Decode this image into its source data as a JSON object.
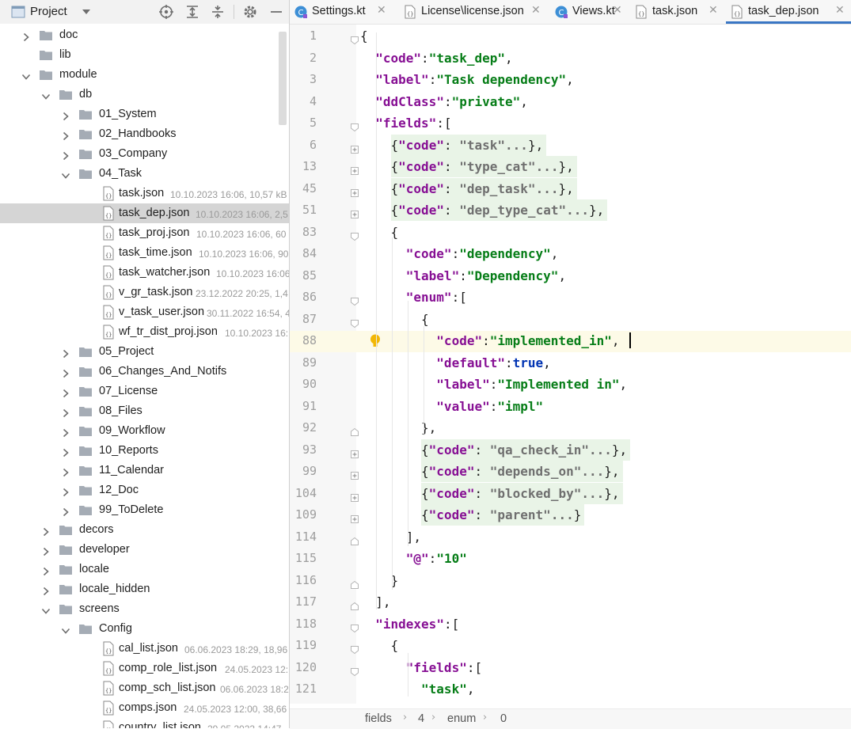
{
  "project_panel": {
    "title": "Project",
    "tree": [
      {
        "name": "doc",
        "type": "folder",
        "expanded": false,
        "meta": ""
      },
      {
        "name": "lib",
        "type": "folder",
        "expanded": null,
        "meta": ""
      },
      {
        "name": "module",
        "type": "folder",
        "expanded": true,
        "meta": ""
      },
      {
        "name": "db",
        "type": "folder",
        "expanded": true,
        "meta": ""
      },
      {
        "name": "01_System",
        "type": "folder",
        "expanded": false,
        "meta": ""
      },
      {
        "name": "02_Handbooks",
        "type": "folder",
        "expanded": false,
        "meta": ""
      },
      {
        "name": "03_Company",
        "type": "folder",
        "expanded": false,
        "meta": ""
      },
      {
        "name": "04_Task",
        "type": "folder",
        "expanded": true,
        "meta": ""
      },
      {
        "name": "task.json",
        "type": "file",
        "meta": "10.10.2023 16:06, 10,57 kB"
      },
      {
        "name": "task_dep.json",
        "type": "file",
        "meta": "10.10.2023 16:06, 2,5",
        "selected": true
      },
      {
        "name": "task_proj.json",
        "type": "file",
        "meta": "10.10.2023 16:06, 60"
      },
      {
        "name": "task_time.json",
        "type": "file",
        "meta": "10.10.2023 16:06, 90"
      },
      {
        "name": "task_watcher.json",
        "type": "file",
        "meta": "10.10.2023 16:06"
      },
      {
        "name": "v_gr_task.json",
        "type": "file",
        "meta": "23.12.2022 20:25, 1,4"
      },
      {
        "name": "v_task_user.json",
        "type": "file",
        "meta": "30.11.2022 16:54, 4"
      },
      {
        "name": "wf_tr_dist_proj.json",
        "type": "file",
        "meta": "10.10.2023 16:"
      },
      {
        "name": "05_Project",
        "type": "folder",
        "expanded": false,
        "meta": ""
      },
      {
        "name": "06_Changes_And_Notifs",
        "type": "folder",
        "expanded": false,
        "meta": ""
      },
      {
        "name": "07_License",
        "type": "folder",
        "expanded": false,
        "meta": ""
      },
      {
        "name": "08_Files",
        "type": "folder",
        "expanded": false,
        "meta": ""
      },
      {
        "name": "09_Workflow",
        "type": "folder",
        "expanded": false,
        "meta": ""
      },
      {
        "name": "10_Reports",
        "type": "folder",
        "expanded": false,
        "meta": ""
      },
      {
        "name": "11_Calendar",
        "type": "folder",
        "expanded": false,
        "meta": ""
      },
      {
        "name": "12_Doc",
        "type": "folder",
        "expanded": false,
        "meta": ""
      },
      {
        "name": "99_ToDelete",
        "type": "folder",
        "expanded": false,
        "meta": ""
      },
      {
        "name": "decors",
        "type": "folder",
        "expanded": false,
        "meta": ""
      },
      {
        "name": "developer",
        "type": "folder",
        "expanded": false,
        "meta": ""
      },
      {
        "name": "locale",
        "type": "folder",
        "expanded": false,
        "meta": ""
      },
      {
        "name": "locale_hidden",
        "type": "folder",
        "expanded": false,
        "meta": ""
      },
      {
        "name": "screens",
        "type": "folder",
        "expanded": true,
        "meta": ""
      },
      {
        "name": "Config",
        "type": "folder",
        "expanded": true,
        "meta": ""
      },
      {
        "name": "cal_list.json",
        "type": "file",
        "meta": "06.06.2023 18:29, 18,96"
      },
      {
        "name": "comp_role_list.json",
        "type": "file",
        "meta": "24.05.2023 12:"
      },
      {
        "name": "comp_sch_list.json",
        "type": "file",
        "meta": "06.06.2023 18:2"
      },
      {
        "name": "comps.json",
        "type": "file",
        "meta": "24.05.2023 12:00, 38,66"
      },
      {
        "name": "country_list.json",
        "type": "file",
        "meta": "29.05.2023 14:47"
      }
    ]
  },
  "tabs": [
    {
      "label": "Settings.kt",
      "icon": "kotlin-file-icon",
      "active": false
    },
    {
      "label": "License\\license.json",
      "icon": "json-file-icon",
      "active": false
    },
    {
      "label": "Views.kt",
      "icon": "kotlin-file-icon",
      "active": false
    },
    {
      "label": "task.json",
      "icon": "json-file-icon",
      "active": false
    },
    {
      "label": "task_dep.json",
      "icon": "json-file-icon",
      "active": true
    }
  ],
  "editor": {
    "current_line": "88",
    "lines": [
      {
        "n": "1",
        "text": "{"
      },
      {
        "n": "2",
        "text": "\"code\":\"task_dep\","
      },
      {
        "n": "3",
        "text": "\"label\":\"Task dependency\","
      },
      {
        "n": "4",
        "text": "\"ddClass\":\"private\","
      },
      {
        "n": "5",
        "text": "\"fields\":["
      },
      {
        "n": "6",
        "text": "{\"code\": \"task\"...},"
      },
      {
        "n": "13",
        "text": "{\"code\": \"type_cat\"...},"
      },
      {
        "n": "45",
        "text": "{\"code\": \"dep_task\"...},"
      },
      {
        "n": "51",
        "text": "{\"code\": \"dep_type_cat\"...},"
      },
      {
        "n": "83",
        "text": "{"
      },
      {
        "n": "84",
        "text": "\"code\":\"dependency\","
      },
      {
        "n": "85",
        "text": "\"label\":\"Dependency\","
      },
      {
        "n": "86",
        "text": "\"enum\":["
      },
      {
        "n": "87",
        "text": "{"
      },
      {
        "n": "88",
        "text": "\"code\":\"implemented_in\","
      },
      {
        "n": "89",
        "text": "\"default\":true,"
      },
      {
        "n": "90",
        "text": "\"label\":\"Implemented in\","
      },
      {
        "n": "91",
        "text": "\"value\":\"impl\""
      },
      {
        "n": "92",
        "text": "},"
      },
      {
        "n": "93",
        "text": "{\"code\": \"qa_check_in\"...},"
      },
      {
        "n": "99",
        "text": "{\"code\": \"depends_on\"...},"
      },
      {
        "n": "104",
        "text": "{\"code\": \"blocked_by\"...},"
      },
      {
        "n": "109",
        "text": "{\"code\": \"parent\"...}"
      },
      {
        "n": "114",
        "text": "],"
      },
      {
        "n": "115",
        "text": "\"@\":\"10\""
      },
      {
        "n": "116",
        "text": "}"
      },
      {
        "n": "117",
        "text": "],"
      },
      {
        "n": "118",
        "text": "\"indexes\":["
      },
      {
        "n": "119",
        "text": "{"
      },
      {
        "n": "120",
        "text": "\"fields\":["
      },
      {
        "n": "121",
        "text": "\"task\","
      }
    ]
  },
  "breadcrumb": [
    "fields",
    "4",
    "enum",
    "0"
  ],
  "colors": {
    "accent": "#3a76c4",
    "key": "#871094",
    "string": "#067d17",
    "keyword": "#0033b3"
  }
}
